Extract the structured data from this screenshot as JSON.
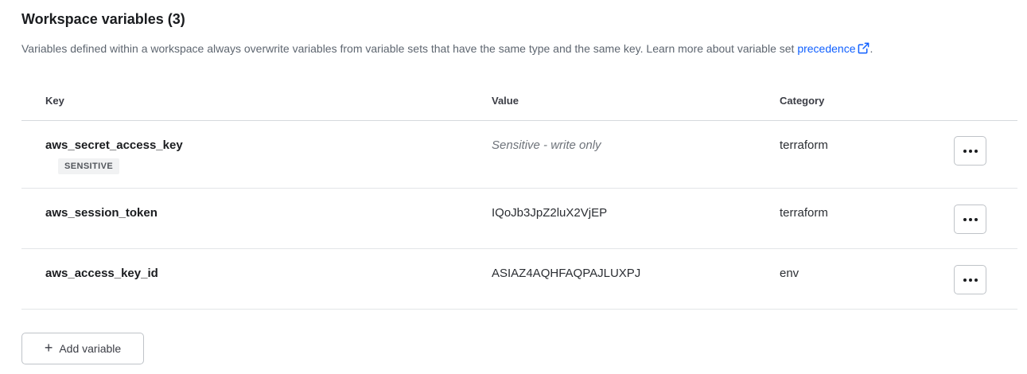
{
  "section": {
    "title": "Workspace variables (3)",
    "description_prefix": "Variables defined within a workspace always overwrite variables from variable sets that have the same type and the same key. Learn more about variable set ",
    "link_text": "precedence",
    "link_icon": "external-link-icon",
    "description_suffix": "."
  },
  "table": {
    "headers": {
      "key": "Key",
      "value": "Value",
      "category": "Category"
    },
    "rows": [
      {
        "key": "aws_secret_access_key",
        "badge": "SENSITIVE",
        "value": "Sensitive - write only",
        "value_sensitive": true,
        "category": "terraform"
      },
      {
        "key": "aws_session_token",
        "value": "IQoJb3JpZ2luX2VjEP",
        "category": "terraform"
      },
      {
        "key": "aws_access_key_id",
        "value": "ASIAZ4AQHFAQPAJLUXPJ",
        "category": "env"
      }
    ],
    "row_action_icon": "ellipsis-icon"
  },
  "actions": {
    "add_variable_label": "Add variable",
    "add_variable_icon": "plus-icon"
  },
  "colors": {
    "link": "#1060ff",
    "badge_bg": "#f1f2f3",
    "border": "#d6d9dd"
  }
}
